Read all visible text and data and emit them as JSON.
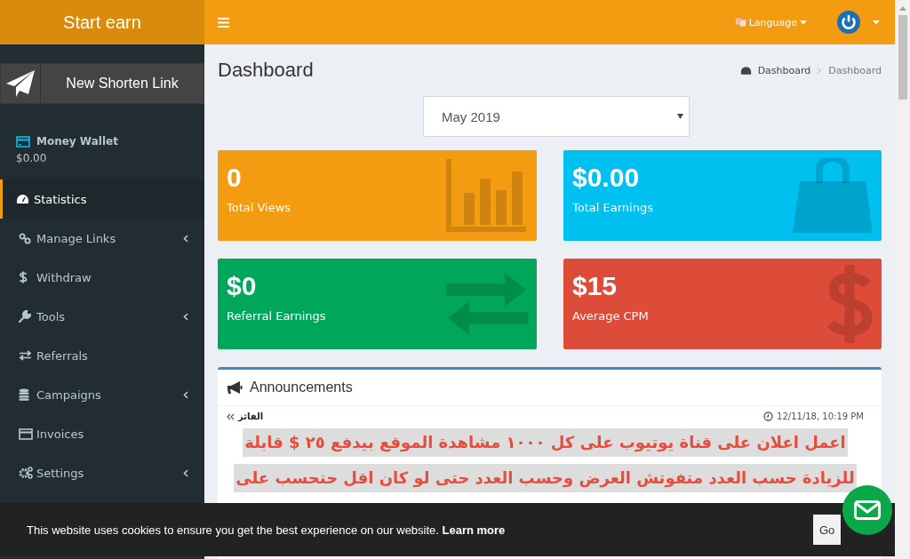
{
  "logo": "Start earn",
  "header": {
    "language": "Language"
  },
  "sidebar": {
    "new_link": "New Shorten Link",
    "wallet": {
      "label": "Money Wallet",
      "amount": "$0.00"
    },
    "items": [
      {
        "label": "Statistics",
        "selected": true,
        "has_submenu": false
      },
      {
        "label": "Manage Links",
        "selected": false,
        "has_submenu": true
      },
      {
        "label": "Withdraw",
        "selected": false,
        "has_submenu": false
      },
      {
        "label": "Tools",
        "selected": false,
        "has_submenu": true
      },
      {
        "label": "Referrals",
        "selected": false,
        "has_submenu": false
      },
      {
        "label": "Campaigns",
        "selected": false,
        "has_submenu": true
      },
      {
        "label": "Invoices",
        "selected": false,
        "has_submenu": false
      },
      {
        "label": "Settings",
        "selected": false,
        "has_submenu": true
      }
    ]
  },
  "page": {
    "title": "Dashboard",
    "breadcrumb": [
      "Dashboard",
      "Dashboard"
    ],
    "month": "May 2019"
  },
  "stats": [
    {
      "value": "0",
      "label": "Total Views",
      "color": "#f39c12"
    },
    {
      "value": "$0.00",
      "label": "Total Earnings",
      "color": "#00c0ef"
    },
    {
      "value": "$0",
      "label": "Referral Earnings",
      "color": "#00a65a"
    },
    {
      "value": "$15",
      "label": "Average CPM",
      "color": "#dd4b39"
    }
  ],
  "announcements": {
    "title": "Announcements",
    "author": "الفائز",
    "time": "12/11/18, 10:19 PM",
    "lines": [
      "اعمل اعلان  على قناة يوتيوب على كل ١٠٠٠ مشاهدة الموقع بيدفع ٢٥ $ قابلة",
      "للزيادة حسب العدد متفوتش العرض وحسب العدد حتى لو كان اقل حتحسب على"
    ]
  },
  "cookie": {
    "text": "This website uses cookies to ensure you get the best experience on our website.",
    "link": "Learn more",
    "button": "Go"
  }
}
